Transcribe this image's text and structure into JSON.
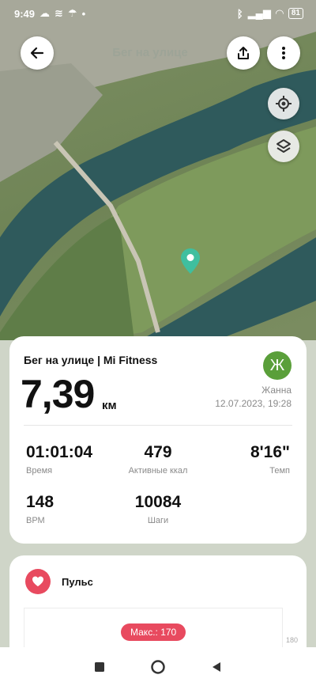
{
  "status_bar": {
    "time": "9:49",
    "battery": "81"
  },
  "header": {
    "title": "Бег на улице"
  },
  "summary": {
    "title": "Бег на улице | Mi Fitness",
    "distance": "7,39",
    "distance_unit": "км",
    "user_initial": "Ж",
    "user_name": "Жанна",
    "datetime": "12.07.2023, 19:28",
    "stats": [
      {
        "value": "01:01:04",
        "label": "Время"
      },
      {
        "value": "479",
        "label": "Активные ккал"
      },
      {
        "value": "8'16\"",
        "label": "Темп"
      },
      {
        "value": "148",
        "label": "ВРМ"
      },
      {
        "value": "10084",
        "label": "Шаги"
      }
    ]
  },
  "pulse": {
    "title": "Пульс",
    "max_badge": "Макс.: 170",
    "y_tick": "180"
  },
  "colors": {
    "accent_green": "#5a9f3a",
    "pulse_red": "#e84a5f",
    "pin_teal": "#3fbf9f"
  },
  "icons": [
    "back-arrow-icon",
    "share-icon",
    "more-vertical-icon",
    "location-target-icon",
    "layers-icon",
    "map-pin-icon",
    "heart-icon"
  ]
}
